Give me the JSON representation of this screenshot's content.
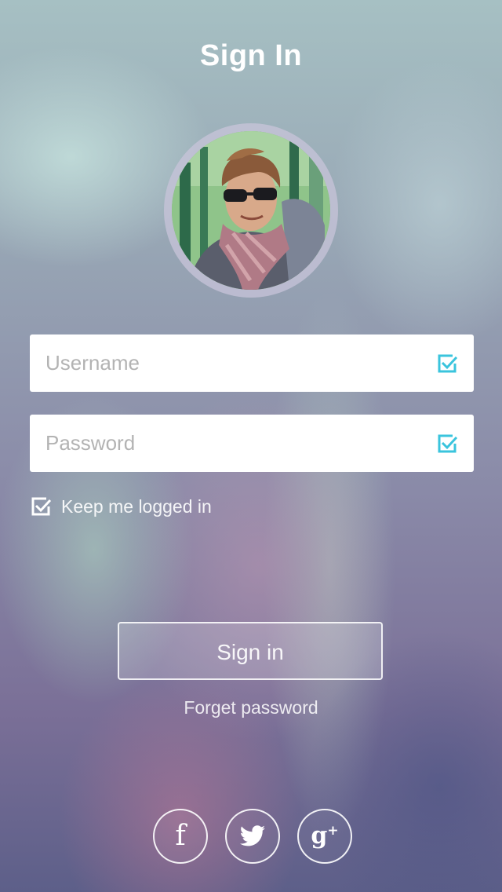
{
  "header": {
    "title": "Sign In"
  },
  "form": {
    "username_placeholder": "Username",
    "password_placeholder": "Password",
    "keep_logged_in_label": "Keep me logged in",
    "keep_logged_in_checked": true,
    "sign_in_label": "Sign in",
    "forget_password_label": "Forget password"
  },
  "social": {
    "facebook_glyph": "f",
    "google_plus_glyph": "g",
    "google_plus_sup": "+"
  },
  "colors": {
    "accent_check": "#3ac4dd",
    "text_light": "#ffffff"
  }
}
